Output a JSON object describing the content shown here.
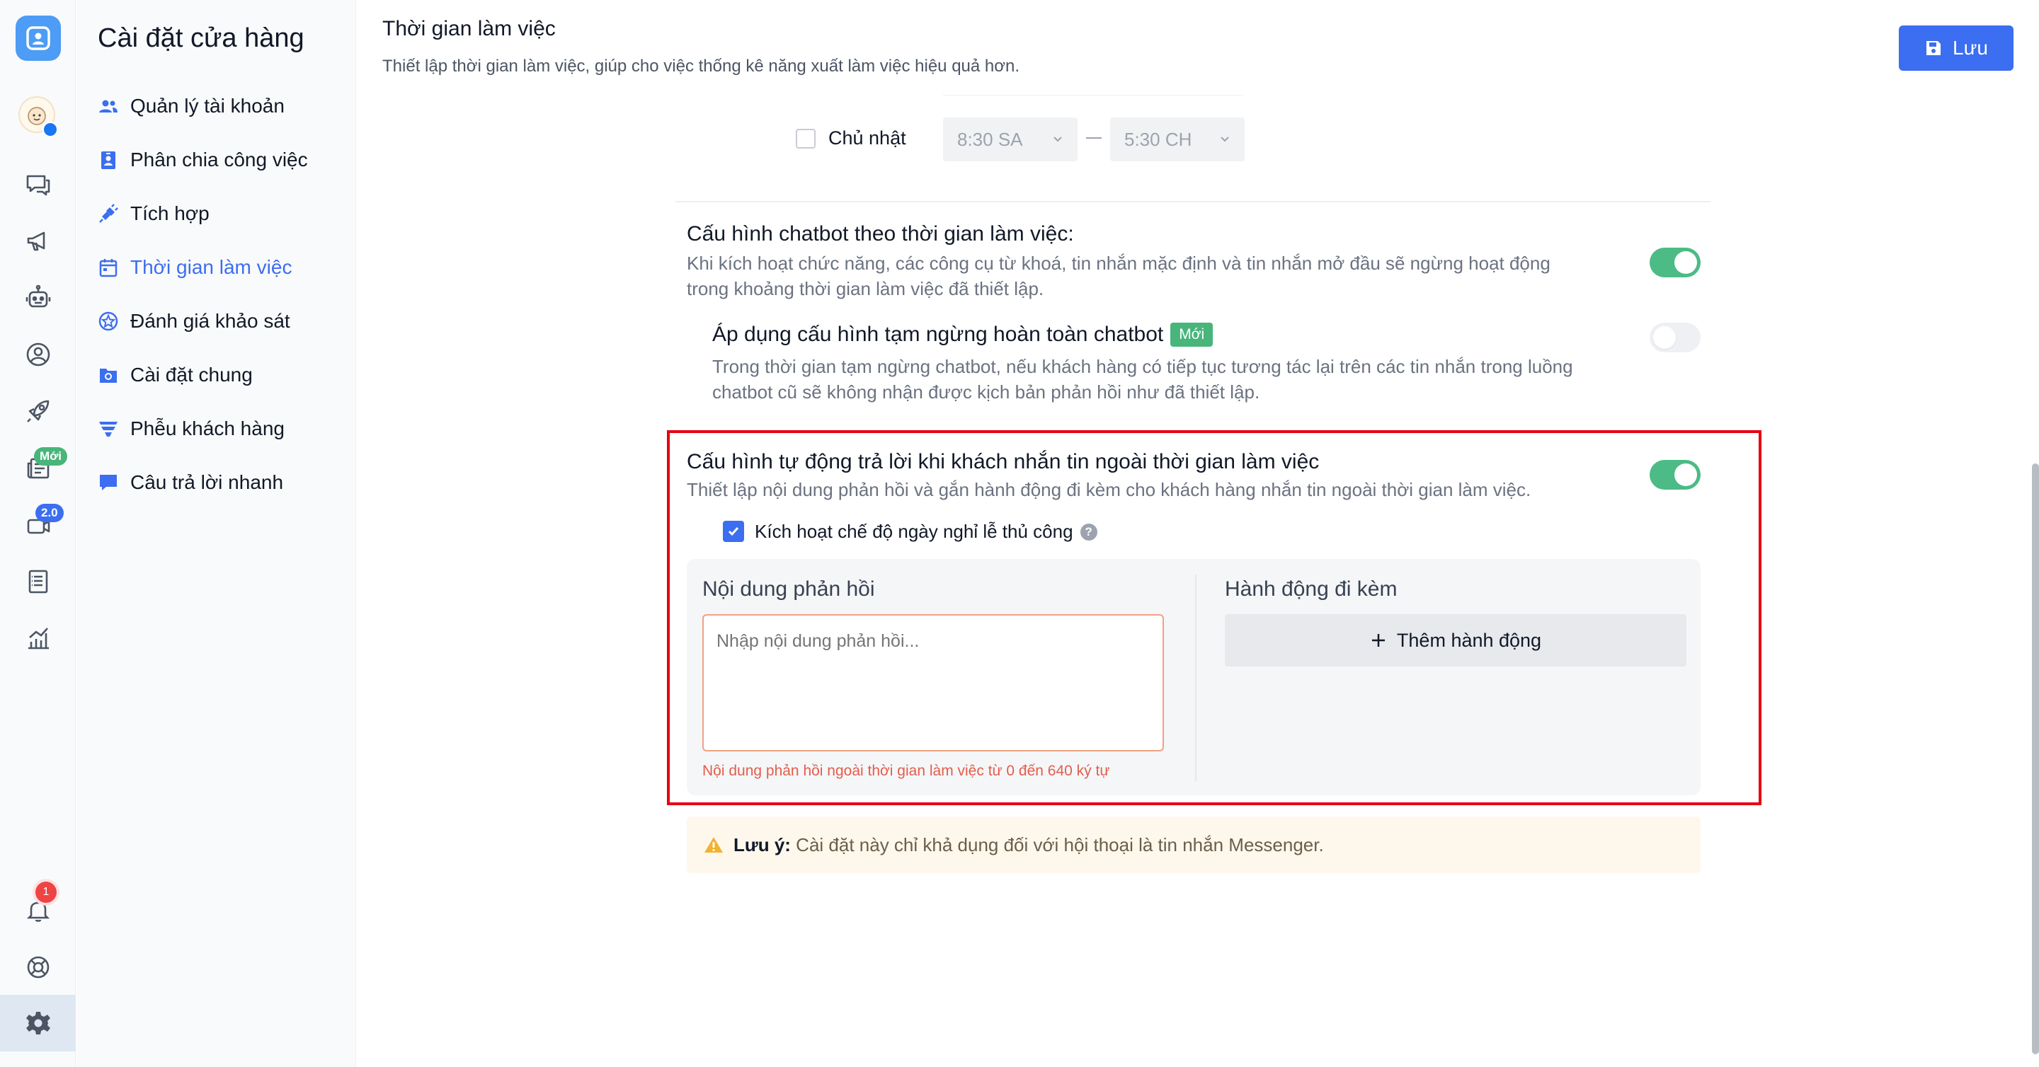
{
  "sidebar": {
    "title": "Cài đặt cửa hàng",
    "items": [
      {
        "label": "Quản lý tài khoản",
        "icon": "users-icon"
      },
      {
        "label": "Phân chia công việc",
        "icon": "id-card-icon"
      },
      {
        "label": "Tích hợp",
        "icon": "plug-icon"
      },
      {
        "label": "Thời gian làm việc",
        "icon": "calendar-icon",
        "active": true
      },
      {
        "label": "Đánh giá khảo sát",
        "icon": "star-badge-icon"
      },
      {
        "label": "Cài đặt chung",
        "icon": "settings-folder-icon"
      },
      {
        "label": "Phễu khách hàng",
        "icon": "funnel-icon"
      },
      {
        "label": "Câu trả lời nhanh",
        "icon": "message-icon"
      }
    ]
  },
  "rail": {
    "badges": {
      "new": "Mới",
      "version": "2.0",
      "notifications": "1"
    },
    "colors": {
      "accent": "#3b6ef0",
      "logo": "#4d9cf5"
    }
  },
  "header": {
    "title": "Thời gian làm việc",
    "subtitle": "Thiết lập thời gian làm việc, giúp cho việc thống kê năng xuất làm việc hiệu quả hơn.",
    "save_label": "Lưu"
  },
  "schedule": {
    "day": "Chủ nhật",
    "checked": false,
    "start": "8:30 SA",
    "end": "5:30 CH"
  },
  "chatbot_config": {
    "title": "Cấu hình chatbot theo thời gian làm việc:",
    "desc": "Khi kích hoạt chức năng, các công cụ từ khoá, tin nhắn mặc định và tin nhắn mở đầu sẽ ngừng hoạt động trong khoảng thời gian làm việc đã thiết lập.",
    "enabled": true
  },
  "pause_config": {
    "title": "Áp dụng cấu hình tạm ngừng hoàn toàn chatbot",
    "badge": "Mới",
    "desc": "Trong thời gian tạm ngừng chatbot, nếu khách hàng có tiếp tục tương tác lại trên các tin nhắn trong luồng chatbot cũ sẽ không nhận được kịch bản phản hồi như đã thiết lập.",
    "enabled": false
  },
  "auto_reply": {
    "title": "Cấu hình tự động trả lời khi khách nhắn tin ngoài thời gian làm việc",
    "desc": "Thiết lập nội dung phản hồi và gắn hành động đi kèm cho khách hàng nhắn tin ngoài thời gian làm việc.",
    "enabled": true,
    "holiday_label": "Kích hoạt chế độ ngày nghỉ lễ thủ công",
    "holiday_checked": true,
    "content_heading": "Nội dung phản hồi",
    "content_placeholder": "Nhập nội dung phản hồi...",
    "content_error": "Nội dung phản hồi ngoài thời gian làm việc từ 0 đến 640 ký tự",
    "action_heading": "Hành động đi kèm",
    "add_action_label": "Thêm hành động"
  },
  "note": {
    "label": "Lưu ý:",
    "text": "Cài đặt này chỉ khả dụng đối với hội thoại là tin nhắn Messenger."
  }
}
